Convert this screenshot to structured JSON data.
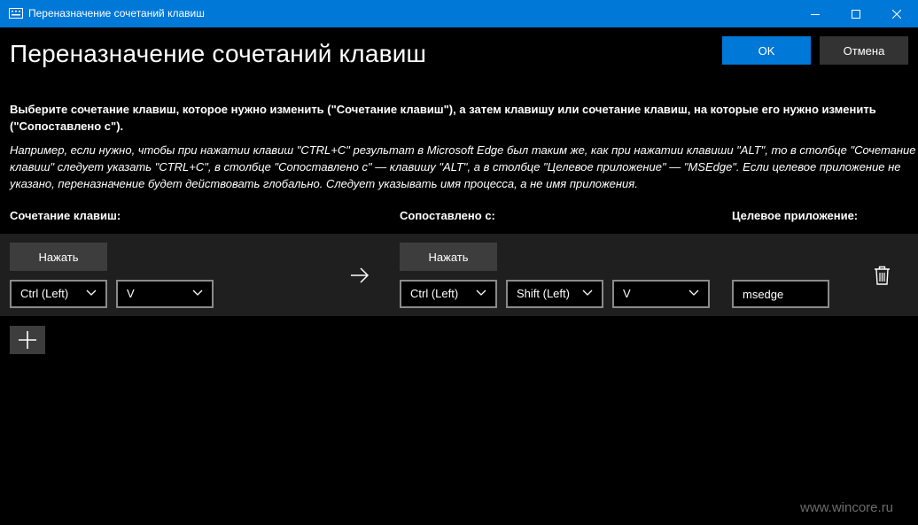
{
  "window": {
    "title": "Переназначение сочетаний клавиш"
  },
  "header": {
    "title": "Переназначение сочетаний клавиш",
    "ok_label": "OK",
    "cancel_label": "Отмена"
  },
  "instructions": "Выберите сочетание клавиш, которое нужно изменить (\"Сочетание клавиш\"), а затем клавишу или сочетание клавиш, на которые его нужно изменить (\"Сопоставлено с\").",
  "example": "Например, если нужно, чтобы при нажатии клавиш \"CTRL+C\" результат в Microsoft Edge был таким же, как при нажатии клавиши \"ALT\", то в столбце \"Сочетание клавиш\" следует указать \"CTRL+C\", в столбце \"Сопоставлено с\" — клавишу \"ALT\", а в столбце \"Целевое приложение\" — \"MSEdge\". Если целевое приложение не указано, переназначение будет действовать глобально. Следует указывать имя процесса, а не имя приложения.",
  "columns": {
    "shortcut": "Сочетание клавиш:",
    "mapped_to": "Сопоставлено с:",
    "target_app": "Целевое приложение:"
  },
  "row": {
    "press_label": "Нажать",
    "source_keys": [
      "Ctrl (Left)",
      "V"
    ],
    "target_keys": [
      "Ctrl (Left)",
      "Shift (Left)",
      "V"
    ],
    "target_app_value": "msedge"
  },
  "watermark": "www.wincore.ru",
  "colors": {
    "accent": "#0078d7",
    "background": "#000000",
    "row_panel": "#1f1f1f",
    "button": "#3d3d3d"
  },
  "icons": {
    "app": "keyboard-icon",
    "minimize": "minimize-icon",
    "maximize": "maximize-icon",
    "close": "close-icon",
    "dropdown": "chevron-down-icon",
    "arrow": "arrow-right-icon",
    "delete": "trash-icon",
    "add": "plus-icon"
  }
}
